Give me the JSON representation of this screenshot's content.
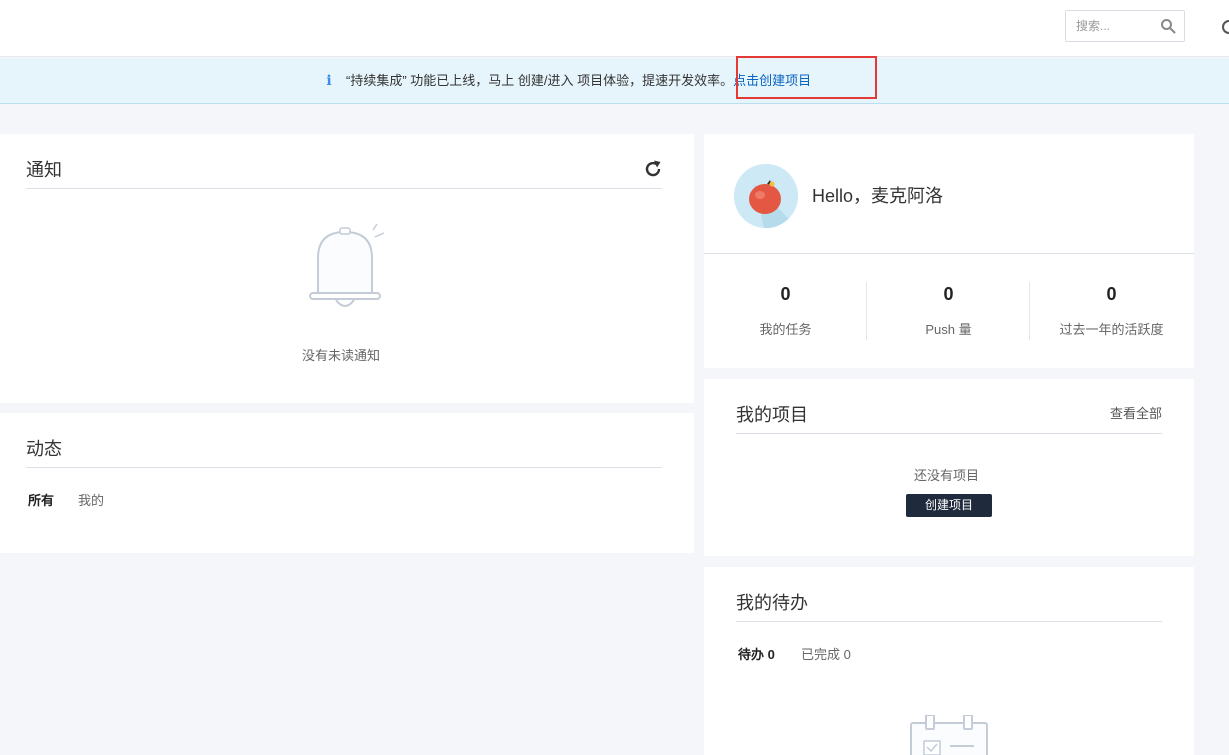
{
  "search": {
    "placeholder": "搜索..."
  },
  "banner": {
    "message": "“持续集成” 功能已上线，马上 创建/进入 项目体验，提速开发效率。",
    "link": "点击创建项目"
  },
  "notifications": {
    "title": "通知",
    "empty_text": "没有未读通知"
  },
  "activity": {
    "title": "动态",
    "filters": [
      "所有",
      "我的"
    ]
  },
  "profile": {
    "greeting": "Hello，麦克阿洛",
    "stats": [
      {
        "value": "0",
        "label": "我的任务"
      },
      {
        "value": "0",
        "label": "Push 量"
      },
      {
        "value": "0",
        "label": "过去一年的活跃度"
      }
    ]
  },
  "projects": {
    "title": "我的项目",
    "view_all": "查看全部",
    "empty_text": "还没有项目",
    "create_button": "创建项目"
  },
  "todo": {
    "title": "我的待办",
    "tabs": [
      "待办 0",
      "已完成 0"
    ]
  },
  "colors": {
    "banner_bg": "#e6f4fb",
    "link": "#0a65c2",
    "primary_button": "#1f2a3d",
    "highlight": "#e53935"
  }
}
